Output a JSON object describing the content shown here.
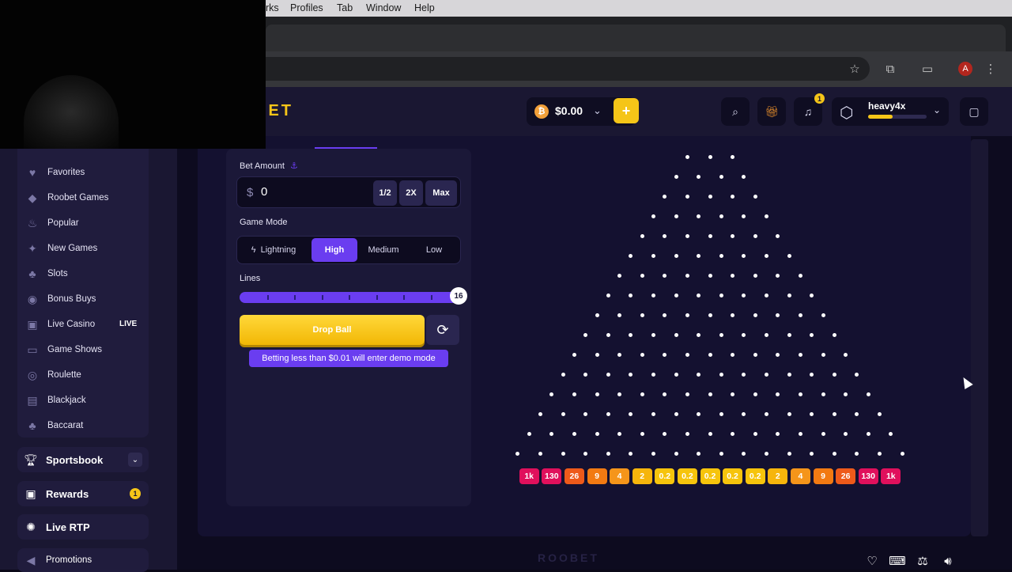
{
  "menubar": {
    "items": [
      "rks",
      "Profiles",
      "Tab",
      "Window",
      "Help"
    ]
  },
  "browser": {
    "avatar_letter": "A"
  },
  "header": {
    "logo_text": "BET",
    "wallet_balance": "$0.00",
    "deposit_symbol": "+",
    "notification_count": "1",
    "username": "heavy4x",
    "xp_progress_percent": 42
  },
  "sidebar": {
    "items": [
      {
        "label": "Favorites",
        "icon": "heart-icon"
      },
      {
        "label": "Roobet Games",
        "icon": "roobet-games-icon"
      },
      {
        "label": "Popular",
        "icon": "flame-icon"
      },
      {
        "label": "New Games",
        "icon": "sparkle-icon"
      },
      {
        "label": "Slots",
        "icon": "cherry-icon"
      },
      {
        "label": "Bonus Buys",
        "icon": "bonus-icon"
      },
      {
        "label": "Live Casino",
        "icon": "live-casino-icon"
      },
      {
        "label": "Game Shows",
        "icon": "tv-icon"
      },
      {
        "label": "Roulette",
        "icon": "roulette-icon"
      },
      {
        "label": "Blackjack",
        "icon": "cards-icon"
      },
      {
        "label": "Baccarat",
        "icon": "club-icon"
      }
    ],
    "live_tag": "LIVE",
    "sportsbook": "Sportsbook",
    "rewards": "Rewards",
    "rewards_badge": "1",
    "live_rtp": "Live RTP",
    "promotions": "Promotions"
  },
  "controls": {
    "bet_amount_label": "Bet Amount",
    "currency_symbol": "$",
    "bet_value": "0",
    "half_label": "1/2",
    "double_label": "2X",
    "max_label": "Max",
    "game_mode_label": "Game Mode",
    "modes": [
      "Lightning",
      "High",
      "Medium",
      "Low"
    ],
    "active_mode": "High",
    "lines_label": "Lines",
    "lines_value": "16",
    "drop_ball_label": "Drop Ball",
    "demo_note": "Betting less than $0.01 will enter demo mode"
  },
  "board": {
    "rows": 16,
    "multipliers": [
      "1k",
      "130",
      "26",
      "9",
      "4",
      "2",
      "0.2",
      "0.2",
      "0.2",
      "0.2",
      "0.2",
      "2",
      "4",
      "9",
      "26",
      "130",
      "1k"
    ],
    "multiplier_colors": [
      "#e0105c",
      "#e0105c",
      "#ee5a1a",
      "#f27a12",
      "#f5951a",
      "#f6b50c",
      "#f6c40c",
      "#f6c40c",
      "#f6c40c",
      "#f6c40c",
      "#f6c40c",
      "#f6b50c",
      "#f5951a",
      "#f27a12",
      "#ee5a1a",
      "#e0105c",
      "#e0105c"
    ]
  },
  "footer": {
    "logo_text": "ROOBET"
  }
}
